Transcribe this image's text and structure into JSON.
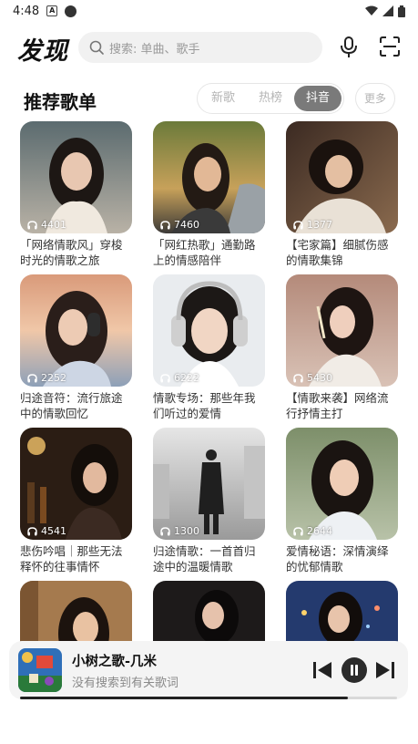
{
  "status_bar": {
    "time": "4:48",
    "notification_letter": "A"
  },
  "header": {
    "logo": "发现",
    "search_placeholder": "搜索: 单曲、歌手"
  },
  "section": {
    "title": "推荐歌单",
    "tabs": [
      {
        "label": "新歌",
        "active": false
      },
      {
        "label": "热榜",
        "active": false
      },
      {
        "label": "抖音",
        "active": true
      }
    ],
    "more_label": "更多"
  },
  "playlists": [
    {
      "title": "「网络情歌风」穿梭时光的情歌之旅",
      "plays": "4401"
    },
    {
      "title": "「网红热歌」通勤路上的情感陪伴",
      "plays": "7460"
    },
    {
      "title": "【宅家篇】细腻伤感的情歌集锦",
      "plays": "1377"
    },
    {
      "title": "归途音符：流行旅途中的情歌回忆",
      "plays": "2252"
    },
    {
      "title": "情歌专场：那些年我们听过的爱情",
      "plays": "6222"
    },
    {
      "title": "【情歌来袭】网络流行抒情主打",
      "plays": "5430"
    },
    {
      "title": "悲伤吟唱｜那些无法释怀的往事情怀",
      "plays": "4541"
    },
    {
      "title": "归途情歌：一首首归途中的温暖情歌",
      "plays": "1300"
    },
    {
      "title": "爱情秘语：深情演绎的忧郁情歌",
      "plays": "2644"
    },
    {
      "title": "",
      "plays": ""
    },
    {
      "title": "",
      "plays": ""
    },
    {
      "title": "",
      "plays": ""
    }
  ],
  "player": {
    "title": "小树之歌-几米",
    "subtitle": "没有搜索到有关歌词",
    "progress": 0.87
  },
  "colors": {
    "accent": "#7a7a7a",
    "player_bg": "#f4f4f4"
  },
  "icons": [
    "search-icon",
    "mic-icon",
    "scan-icon",
    "headphones-icon",
    "prev-icon",
    "pause-icon",
    "next-icon"
  ]
}
